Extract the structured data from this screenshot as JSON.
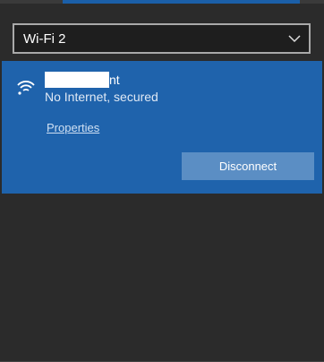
{
  "adapter": {
    "selected": "Wi-Fi 2",
    "chevron_icon": "chevron-down-icon"
  },
  "network": {
    "name_visible_tail": "nt",
    "status": "No Internet, secured",
    "icon": "wifi-signal-icon",
    "properties_label": "Properties",
    "disconnect_label": "Disconnect"
  },
  "colors": {
    "panel_background": "#2b2b2b",
    "selected_network_background": "#1f63ac",
    "button_background": "#5b8ec4",
    "select_border": "#a9a9a9"
  }
}
